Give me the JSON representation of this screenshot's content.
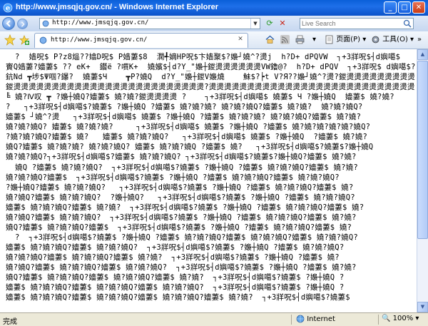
{
  "window": {
    "title": "http://www.jmsqjq.gov.cn/ - Windows Internet Explorer"
  },
  "address": {
    "url": "http://www.jmsqjq.gov.cn/"
  },
  "search": {
    "placeholder": "Live Search"
  },
  "tab": {
    "title": "http://www.jmsqjq.gov.cn/"
  },
  "commands": {
    "page": "页面(P)",
    "tools": "工具(O)"
  },
  "content": {
    "text": "  ?  嫱呪$ P?z8煰??嬆D呪$ P嫱萋$8  澖╃嫡HP呪$卞嫱聚$?嬝┘嬈^?燙j  h?D+ dPQVW  ┐+3牂呪$┤d嬩噶$\n賨Q嫱萋?嬙萋$ ?? eK+  鑙ё ?嘪K+  嬈嬪$┤d?Y_\"嬝┼鍐燙燙燙燙燙燙VW鑥@?  h?D+ dPQV  ┐+3牂呪$ d嬩噶$?  eK+ 3\n鈧Nd ┳埗$Ψ啯?鑤?  嬈萋$Ч    ┳P?嬈Q  d?Y_\"嬝┼鍐V嬝燒    鮇$?┝t V?Я??嬝┘嬈^?燙?鍐燙燙燙燙燙燙燙燙燙\n鍐燙燙燙燙燙燙燙燙燙燙燙燙燙燙燙燙燙燙燙燙燙燙燙燙燙?燙燙燙燙燙燙燙燙燙燙燙燙燙燙燙燙燙燙燙燙燙燙燙燙燙燙燙\n╚ 嬈?Ⅳ叹 ┳ ?嬝┼嬈Q?嬙萋$ 嬈?嬈?鍐燙燙燙燙 ?    ┐+3牂呪$┤d嬩噶$ 嬈萋$ Ч ?嬝┼嬈Q  嬙萋$ 嬈?嬈?\n?   ┐+3牂呪$┤d嬩噶$?嬈萋$ ?嬝┼嬈Q ?嬙萋$ 嬈?嬈?嬈? 嬈?嬈?嬈Q?嬙萋$ 嬈?嬈?  嬈?嬈?嬈Q?\n嬙萋$ ┘嬈^?燙   ┐+3牂呪$┤d嬩噶$ 嬈萋$ ?嬝┼嬈Q ?嬙萋$ 嬈?嬈?嬈? 嬈?嬈?嬈Q?嬙萋$ 嬈?嬈?\n嬈?嬈?嬈Q? 嬙萋$ 嬈?嬈?嬈?     ┐+3牂呪$┤d嬩噶$ 嬈萋$ ?嬝┼嬈Q ?嬙萋$ 嬈?嬈?嬈?嬈?嬈?嬈Q?\n?嬈?嬈?嬈Q?嬙萋$ 嬈?   嬙萋$ 嬈?嬈?嬈Q?   ┐+3牂呪$┤d嬩噶$ 嬈萋$ ?嬝┼嬈Q  ?嬙萋$ 嬈?嬈?\n嬈Q?嬙萋$ 嬈?嬈?嬈? 嬈?嬈?嬈Q? 嬙萋$ 嬈?嬈?嬈Q ?嬙萋$ 嬈?   ┐+3牂呪$┤d嬩噶$?嬈萋$?嬝┼嬈Q\n嬈?嬈?嬈Q?┐+3牂呪$┤d嬩噶$?嬙萋$ 嬈?嬈?嬈Q? ┐+3牂呪$┤d嬩噶$?嬈萋$?嬝┼嬈Q?嬙萋$ 嬈?嬈?\n  嬈Q ?嬙萋$ 嬈?嬈?嬈Q?  ┐+3牂呪$┤d嬩噶$?嬈萋$ ?嬝┼嬈Q ?嬙萋$ 嬈?嬈?嬈Q?嬙萋$ 嬈?嬈?\n嬈?嬈?嬈Q?嬙萋$  ┐+3牂呪$┤d嬩噶$?嬈萋$ ?嬝┼嬈Q ?嬙萋$ 嬈?嬈?嬈Q?嬙萋$ 嬈?嬈?嬈Q?\n?嬝┼嬈Q?嬙萋$ 嬈?嬈?嬈Q?   ┐+3牂呪$┤d嬩噶$?嬈萋$ ?嬝┼嬈Q ?嬙萋$ 嬈?嬈?嬈Q?嬙萋$ 嬈?\n嬈?嬈Q?嬙萋$ 嬈?嬈?嬈Q?  ?嬝┼嬈Q?   ┐+3牂呪$┤d嬩噶$?嬈萋$ ?嬝┼嬈Q ?嬙萋$ 嬈?嬈?嬈Q?\n嬙萋$ 嬈?嬈?嬈Q?嬙萋$ 嬈?嬈?  ┐+3牂呪$┤d嬩噶$?嬈萋$ ?嬝┼嬈Q ?嬙萋$ 嬈?嬈?嬈Q?嬙萋$ 嬈?\n嬈?嬈Q?嬙萋$ 嬈?嬈?嬈Q?  ┐+3牂呪$┤d嬩噶$?嬈萋$ ?嬝┼嬈Q ?嬙萋$ 嬈?嬈?嬈Q?嬙萋$ 嬈?嬈?\n嬈Q?嬙萋$ 嬈?嬈?嬈Q?嬙萋$  ┐+3牂呪$┤d嬩噶$?嬈萋$ ?嬝┼嬈Q ?嬙萋$ 嬈?嬈?嬈Q?嬙萋$ 嬈?\n  ?  ┐+3牂呪$┤d嬩噶$?嬈萋$ ?嬝┼嬈Q ?嬙萋$ 嬈?嬈?嬈Q?嬙萋$ 嬈?嬈?嬈Q?嬙萋$ 嬈?嬈?嬈Q?\n嬙萋$ 嬈?嬈?嬈Q?嬙萋$ 嬈?嬈?嬈Q?  ┐+3牂呪$┤d嬩噶$?嬈萋$ ?嬝┼嬈Q ?嬙萋$ 嬈?嬈?嬈Q?\n嬈?嬈?嬈Q?嬙萋$ 嬈?嬈?嬈Q?嬙萋$ 嬈?嬈?  ┐+3牂呪$┤d嬩噶$?嬈萋$ ?嬝┼嬈Q ?嬙萋$ 嬈?\n嬈?嬈Q?嬙萋$ 嬈?嬈?嬈Q?嬙萋$ 嬈?嬈?嬈Q?  ┐+3牂呪$┤d嬩噶$?嬈萋$ ?嬝┼嬈Q ?嬙萋$ 嬈?嬈?\n嬈Q?嬙萋$ 嬈?嬈?嬈Q?嬙萋$ 嬈?嬈?嬈Q?嬙萋$ 嬈?嬈?  ┐+3牂呪$┤d嬩噶$?嬈萋$ ?嬝┼嬈Q ?\n嬙萋$ 嬈?嬈?嬈Q?嬙萋$ 嬈?嬈?嬈Q?嬙萋$ 嬈?嬈?嬈Q?  ┐+3牂呪$┤d嬩噶$?嬈萋$ ?嬝┼嬈Q ?\n嬙萋$ 嬈?嬈?嬈Q?嬙萋$ 嬈?嬈?嬈Q?嬙萋$ 嬈?嬈?嬈Q?嬙萋$ 嬈?嬈?  ┐+3牂呪$┤d嬩噶$?嬈萋$"
  },
  "status": {
    "text": "完成",
    "zone": "Internet",
    "zoom": "100%"
  }
}
